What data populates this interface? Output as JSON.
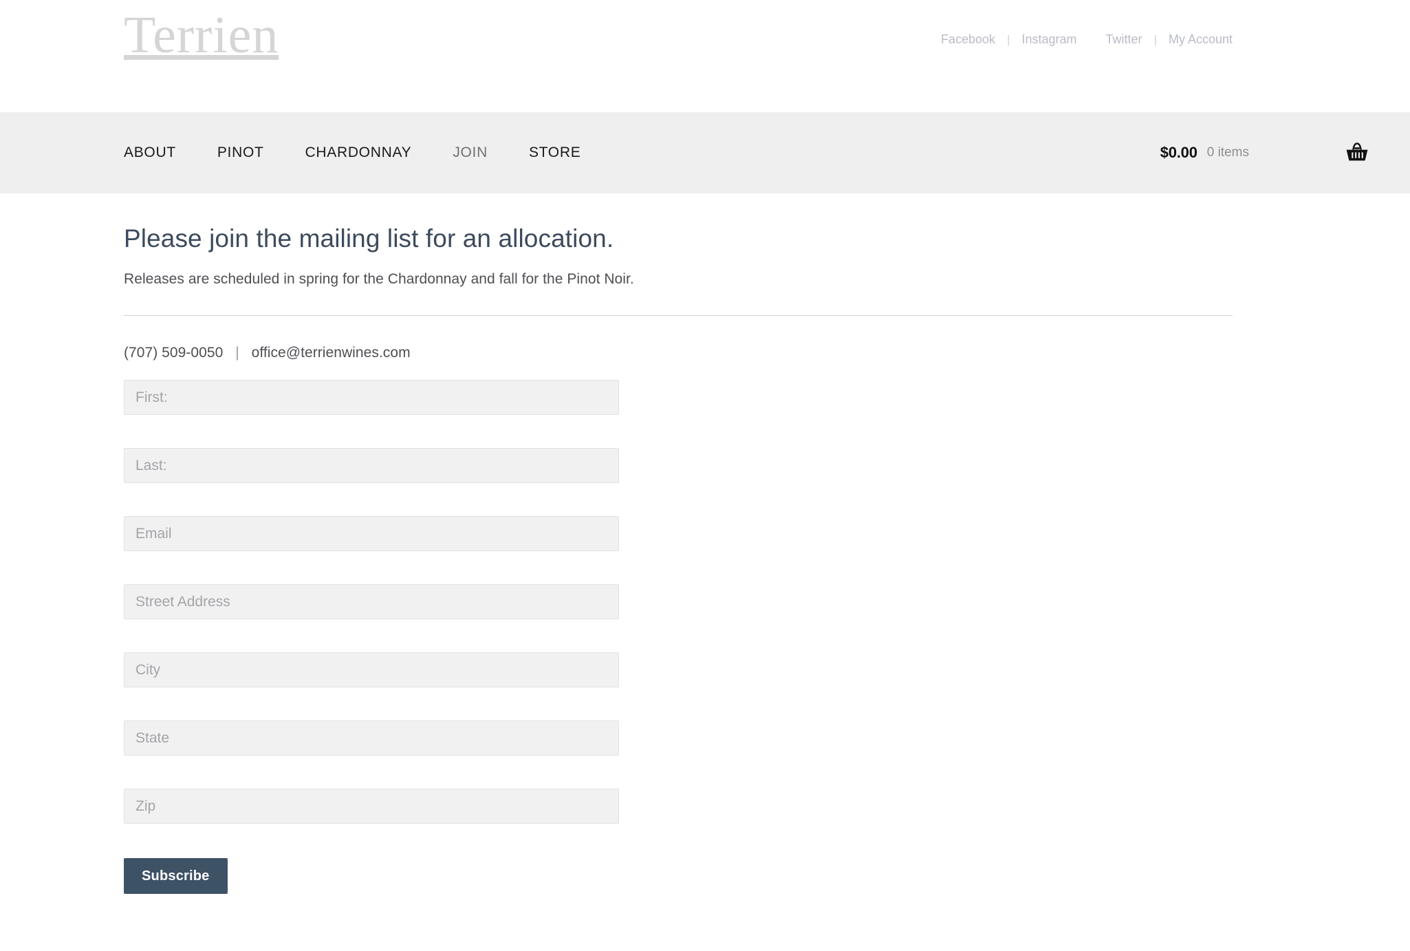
{
  "brand": {
    "name": "Terrien"
  },
  "utility_nav": {
    "separator": "|",
    "items": [
      {
        "label": "Facebook"
      },
      {
        "label": "Instagram"
      },
      {
        "label": "Twitter"
      },
      {
        "label": "My Account"
      }
    ]
  },
  "main_nav": {
    "items": [
      {
        "label": "ABOUT",
        "current": false
      },
      {
        "label": "PINOT",
        "current": false
      },
      {
        "label": "CHARDONNAY",
        "current": false
      },
      {
        "label": "JOIN",
        "current": true
      },
      {
        "label": "STORE",
        "current": false
      }
    ]
  },
  "cart": {
    "total": "$0.00",
    "count_label": "0 items",
    "icon": "shopping-basket-icon"
  },
  "page": {
    "title": "Please join the mailing list for an allocation.",
    "subtitle": "Releases are scheduled in spring for the Chardonnay and fall for the Pinot Noir."
  },
  "contact": {
    "phone": "(707) 509-0050",
    "separator": "|",
    "email": "office@terrienwines.com"
  },
  "form": {
    "fields": [
      {
        "name": "first",
        "placeholder": "First:",
        "value": ""
      },
      {
        "name": "last",
        "placeholder": "Last:",
        "value": ""
      },
      {
        "name": "email",
        "placeholder": "Email",
        "value": ""
      },
      {
        "name": "street",
        "placeholder": "Street Address",
        "value": ""
      },
      {
        "name": "city",
        "placeholder": "City",
        "value": ""
      },
      {
        "name": "state",
        "placeholder": "State",
        "value": ""
      },
      {
        "name": "zip",
        "placeholder": "Zip",
        "value": ""
      }
    ],
    "submit_label": "Subscribe"
  },
  "colors": {
    "nav_bar_bg": "#efefef",
    "page_bg": "#ffffff",
    "heading": "#3c4b5c",
    "logo": "#d5d5d7",
    "button": "#3e5266",
    "field_bg": "#f1f1f1",
    "field_border": "#e2e2e2",
    "rule": "#cfcfcf"
  }
}
